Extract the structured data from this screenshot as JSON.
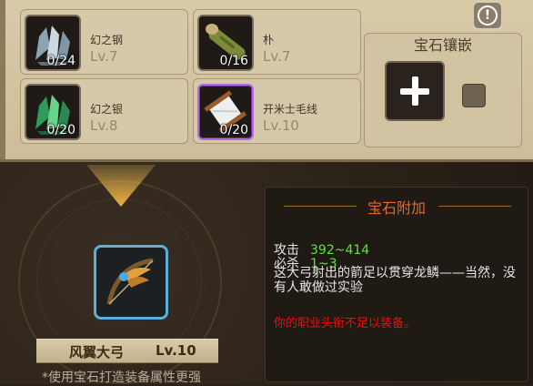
{
  "materials": [
    {
      "name": "幻之钢",
      "level": "Lv.7",
      "count": "0/24",
      "icon": "steel-crystal-icon",
      "rarity": "normal"
    },
    {
      "name": "朴",
      "level": "Lv.7",
      "count": "0/16",
      "icon": "wood-log-icon",
      "rarity": "normal"
    },
    {
      "name": "幻之银",
      "level": "Lv.8",
      "count": "0/20",
      "icon": "silver-crystal-icon",
      "rarity": "normal"
    },
    {
      "name": "开米士毛线",
      "level": "Lv.10",
      "count": "0/20",
      "icon": "yarn-spool-icon",
      "rarity": "purple"
    }
  ],
  "gem_panel": {
    "title": "宝石镶嵌"
  },
  "item": {
    "name": "风翼大弓",
    "level": "Lv.10",
    "icon": "winged-bow-icon"
  },
  "tip": "*使用宝石打造装备属性更强",
  "info": {
    "title": "宝石附加",
    "stats": [
      {
        "label": "攻击",
        "value": "392~414"
      },
      {
        "label": "必杀",
        "value": "1~3"
      }
    ],
    "description": "这大弓射出的箭足以贯穿龙鳞——当然，没有人敢做过实验",
    "warning": "你的职业头衔不足以装备。"
  },
  "colors": {
    "stat_value": "#5fe23a",
    "warning": "#f20c0c",
    "title": "#e36a28",
    "purple_frame": "#b36de0",
    "item_frame": "#5ab0d8"
  }
}
